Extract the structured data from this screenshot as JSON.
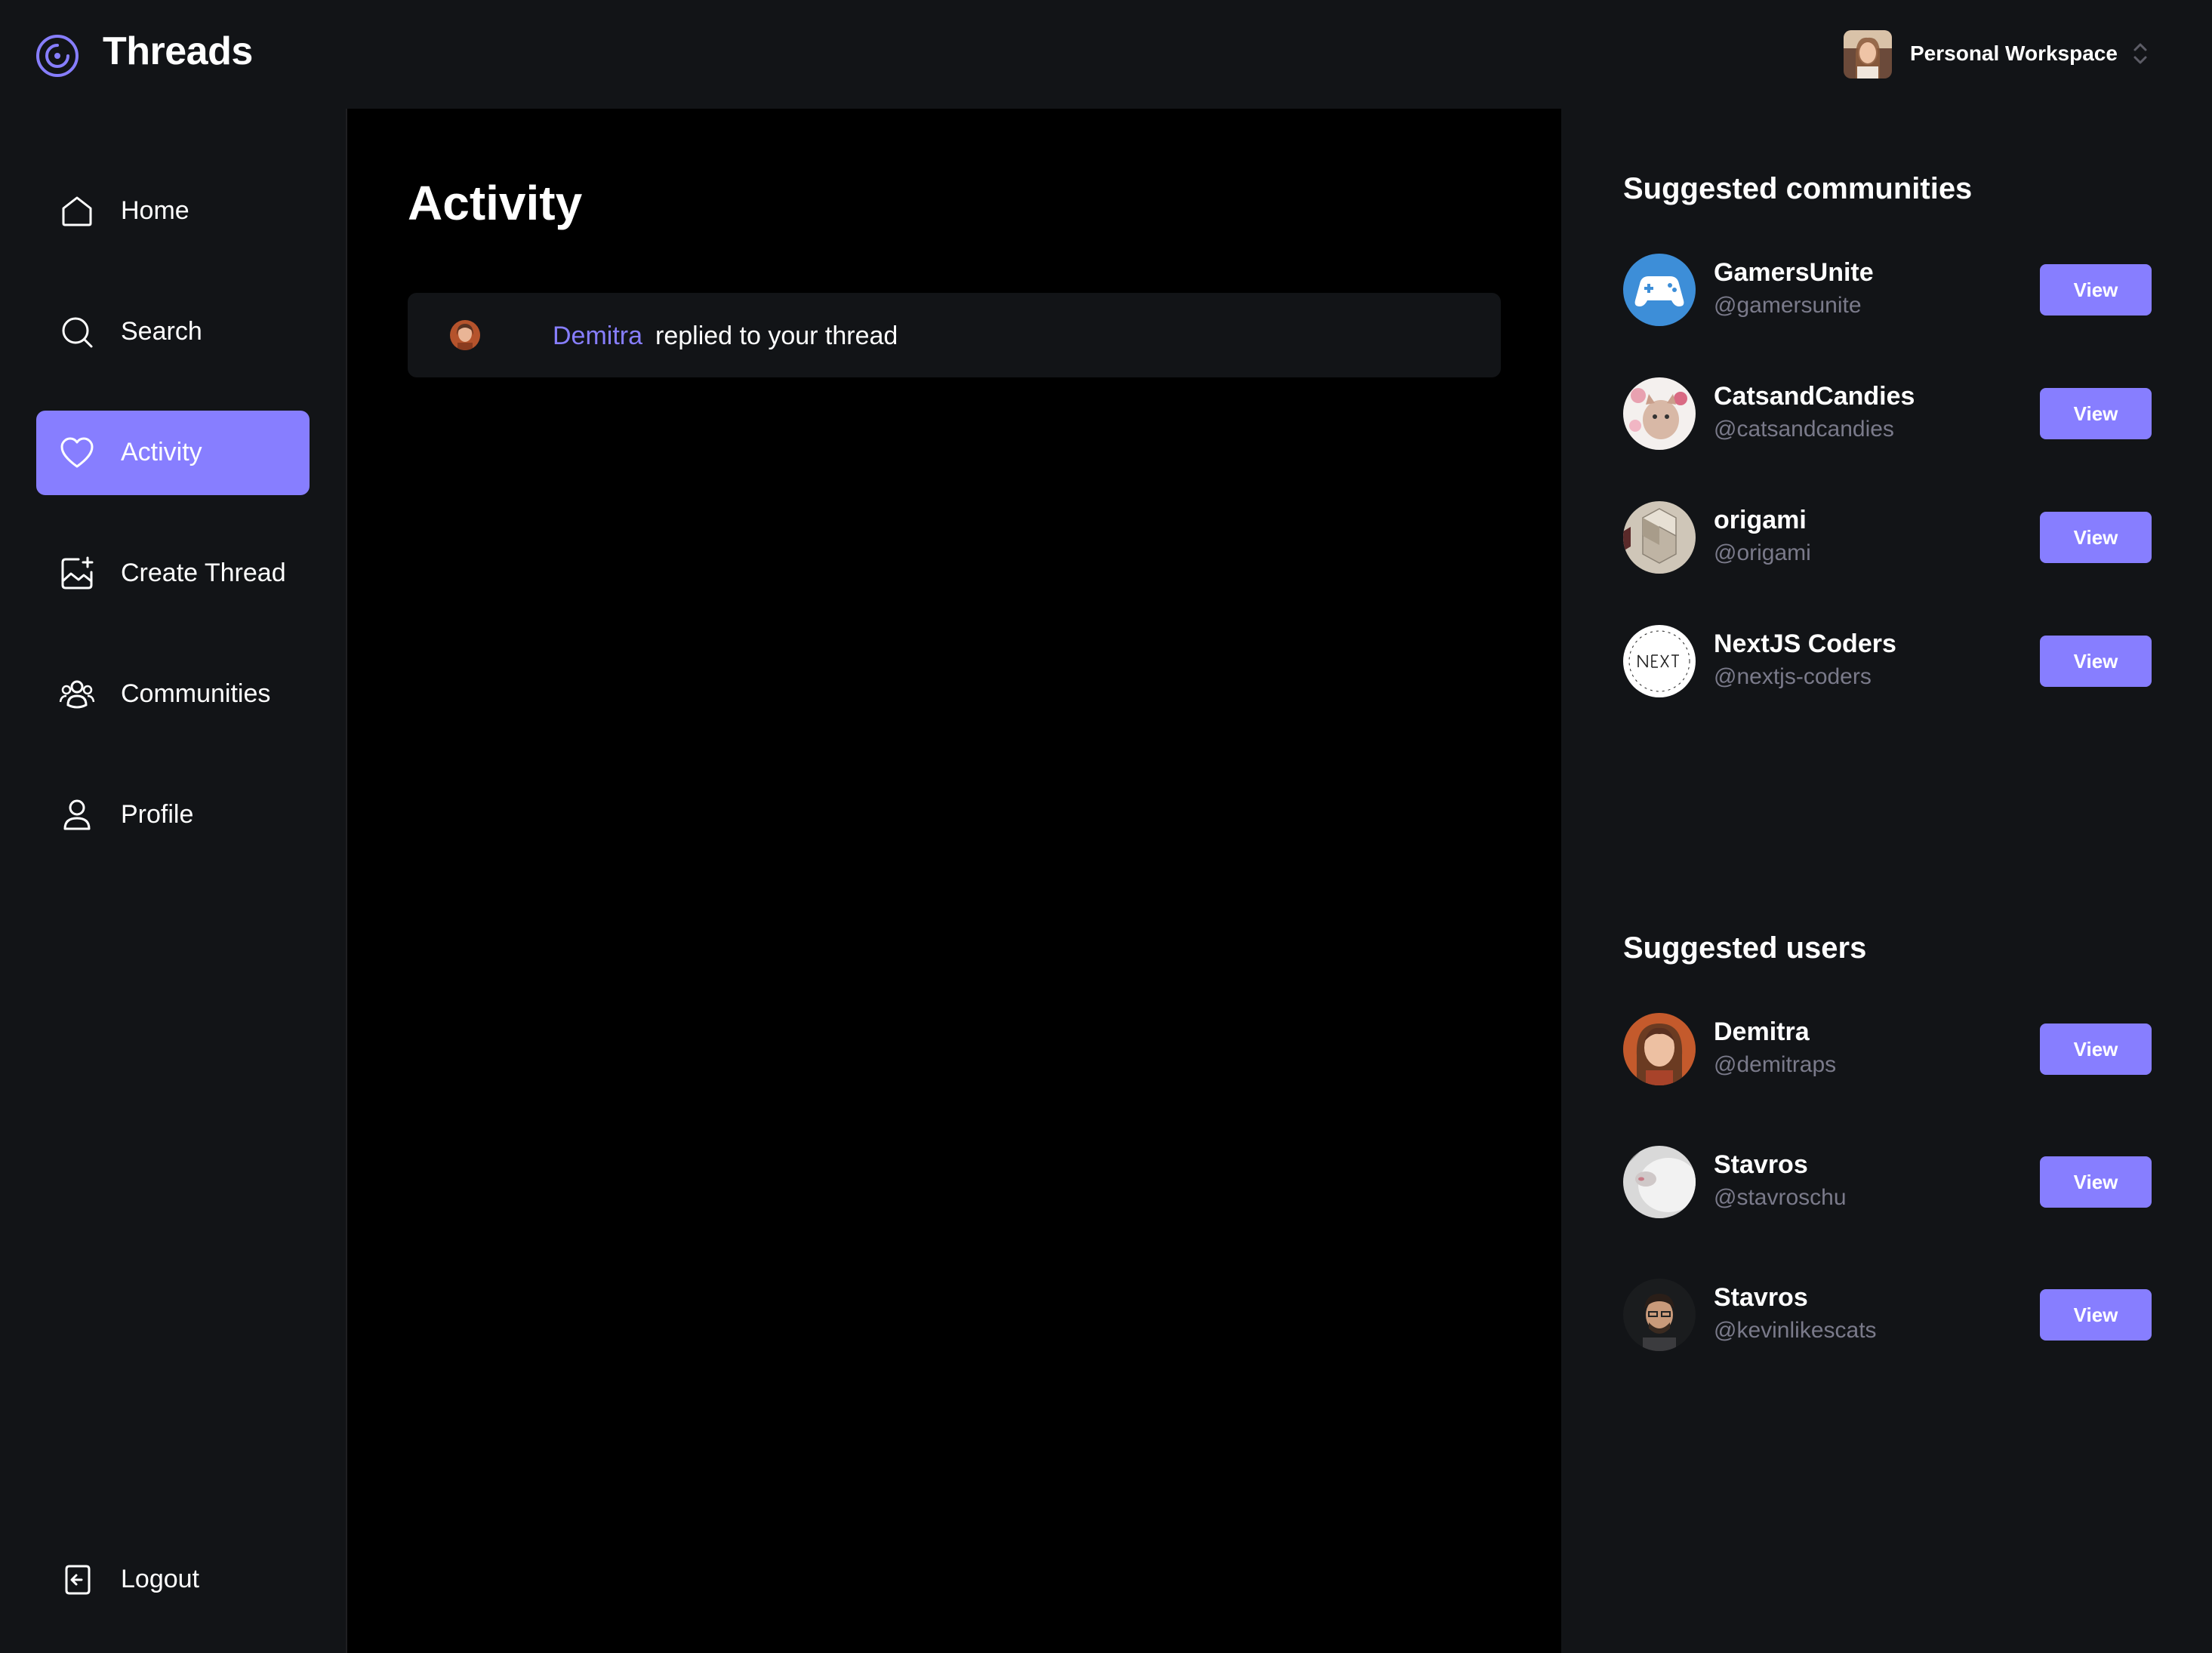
{
  "app": {
    "title": "Threads"
  },
  "workspace": {
    "label": "Personal Workspace"
  },
  "colors": {
    "accent": "#877EFF",
    "bg_dark": "#121417",
    "main_bg": "#000000",
    "muted": "#7A7A8A"
  },
  "sidebar": {
    "items": [
      {
        "label": "Home",
        "icon": "home-icon",
        "active": false
      },
      {
        "label": "Search",
        "icon": "search-icon",
        "active": false
      },
      {
        "label": "Activity",
        "icon": "heart-icon",
        "active": true
      },
      {
        "label": "Create Thread",
        "icon": "image-plus-icon",
        "active": false
      },
      {
        "label": "Communities",
        "icon": "users-icon",
        "active": false
      },
      {
        "label": "Profile",
        "icon": "user-icon",
        "active": false
      }
    ],
    "logout": {
      "label": "Logout",
      "icon": "logout-icon"
    }
  },
  "main": {
    "title": "Activity",
    "activities": [
      {
        "user": "Demitra",
        "text": "replied to your thread"
      }
    ]
  },
  "suggested_communities": {
    "title": "Suggested communities",
    "items": [
      {
        "name": "GamersUnite",
        "handle": "@gamersunite",
        "button": "View"
      },
      {
        "name": "CatsandCandies",
        "handle": "@catsandcandies",
        "button": "View"
      },
      {
        "name": "origami",
        "handle": "@origami",
        "button": "View"
      },
      {
        "name": "NextJS Coders",
        "handle": "@nextjs-coders",
        "button": "View"
      }
    ]
  },
  "suggested_users": {
    "title": "Suggested users",
    "items": [
      {
        "name": "Demitra",
        "handle": "@demitraps",
        "button": "View"
      },
      {
        "name": "Stavros",
        "handle": "@stavroschu",
        "button": "View"
      },
      {
        "name": "Stavros",
        "handle": "@kevinlikescats",
        "button": "View"
      }
    ]
  }
}
